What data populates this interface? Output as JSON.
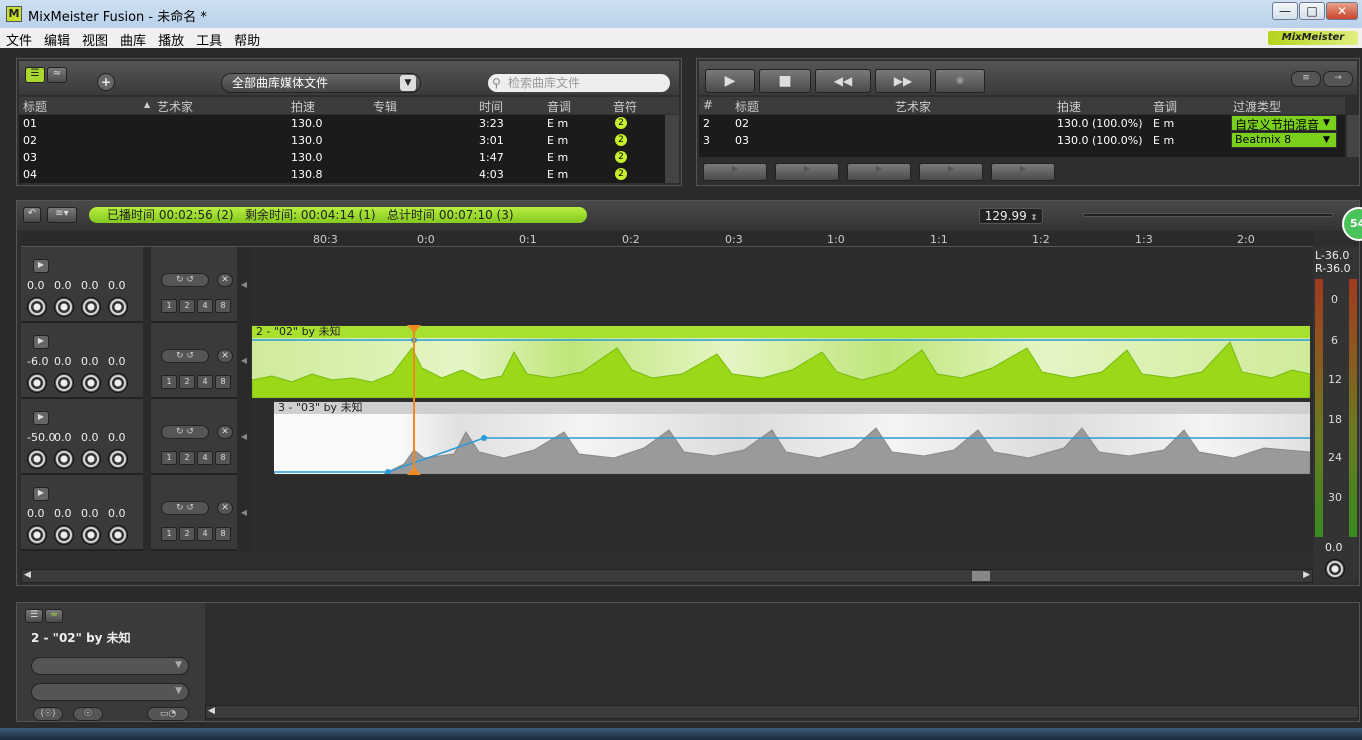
{
  "window": {
    "title": "MixMeister Fusion - 未命名 *",
    "logo_letter": "M"
  },
  "menu": [
    "文件",
    "编辑",
    "视图",
    "曲库",
    "播放",
    "工具",
    "帮助"
  ],
  "brand": "MixMeister",
  "library": {
    "source_selected": "全部曲库媒体文件",
    "search_placeholder": "检索曲库文件",
    "columns": [
      "标题",
      "艺术家",
      "拍速",
      "专辑",
      "时间",
      "音调",
      "音符"
    ],
    "rows": [
      {
        "title": "01",
        "bpm": "130.0",
        "time": "3:23",
        "key": "E m",
        "note": "2"
      },
      {
        "title": "02",
        "bpm": "130.0",
        "time": "3:01",
        "key": "E m",
        "note": "2"
      },
      {
        "title": "03",
        "bpm": "130.0",
        "time": "1:47",
        "key": "E m",
        "note": "2"
      },
      {
        "title": "04",
        "bpm": "130.8",
        "time": "4:03",
        "key": "E m",
        "note": "2"
      }
    ]
  },
  "playlist": {
    "columns": [
      "#",
      "标题",
      "艺术家",
      "拍速",
      "音调",
      "过渡类型"
    ],
    "rows": [
      {
        "num": "2",
        "title": "02",
        "bpm": "130.0 (100.0%)",
        "key": "E m",
        "transition": "自定义节拍混音"
      },
      {
        "num": "3",
        "title": "03",
        "bpm": "130.0 (100.0%)",
        "key": "E m",
        "transition": "Beatmix 8"
      }
    ]
  },
  "timeline": {
    "status": {
      "played": "已播时间 00:02:56 (2)",
      "remaining": "剩余时间: 00:04:14 (1)",
      "total": "总计时间 00:07:10 (3)"
    },
    "tempo": "129.99",
    "badge": "54",
    "ruler": [
      "80:3",
      "0:0",
      "0:1",
      "0:2",
      "0:3",
      "1:0",
      "1:1",
      "1:2",
      "1:3",
      "2:0"
    ],
    "tracks": [
      {
        "vals": [
          "0.0",
          "0.0",
          "0.0",
          "0.0"
        ]
      },
      {
        "vals": [
          "-6.0",
          "0.0",
          "0.0",
          "0.0"
        ]
      },
      {
        "vals": [
          "-50.0",
          "0.0",
          "0.0",
          "0.0"
        ]
      },
      {
        "vals": [
          "0.0",
          "0.0",
          "0.0",
          "0.0"
        ]
      }
    ],
    "beat_labels": [
      "1",
      "2",
      "4",
      "8"
    ],
    "clips": [
      {
        "label": "2 - \"02\" by 未知",
        "color": "#a8e030"
      },
      {
        "label": "3 - \"03\" by 未知",
        "color": "#cfcfcf"
      }
    ],
    "meter": {
      "l": "L-36.0",
      "r": "R-36.0",
      "scale": [
        "0",
        "6",
        "12",
        "18",
        "24",
        "30"
      ],
      "master": "0.0"
    }
  },
  "detail": {
    "track_label": "2 - \"02\" by 未知"
  }
}
